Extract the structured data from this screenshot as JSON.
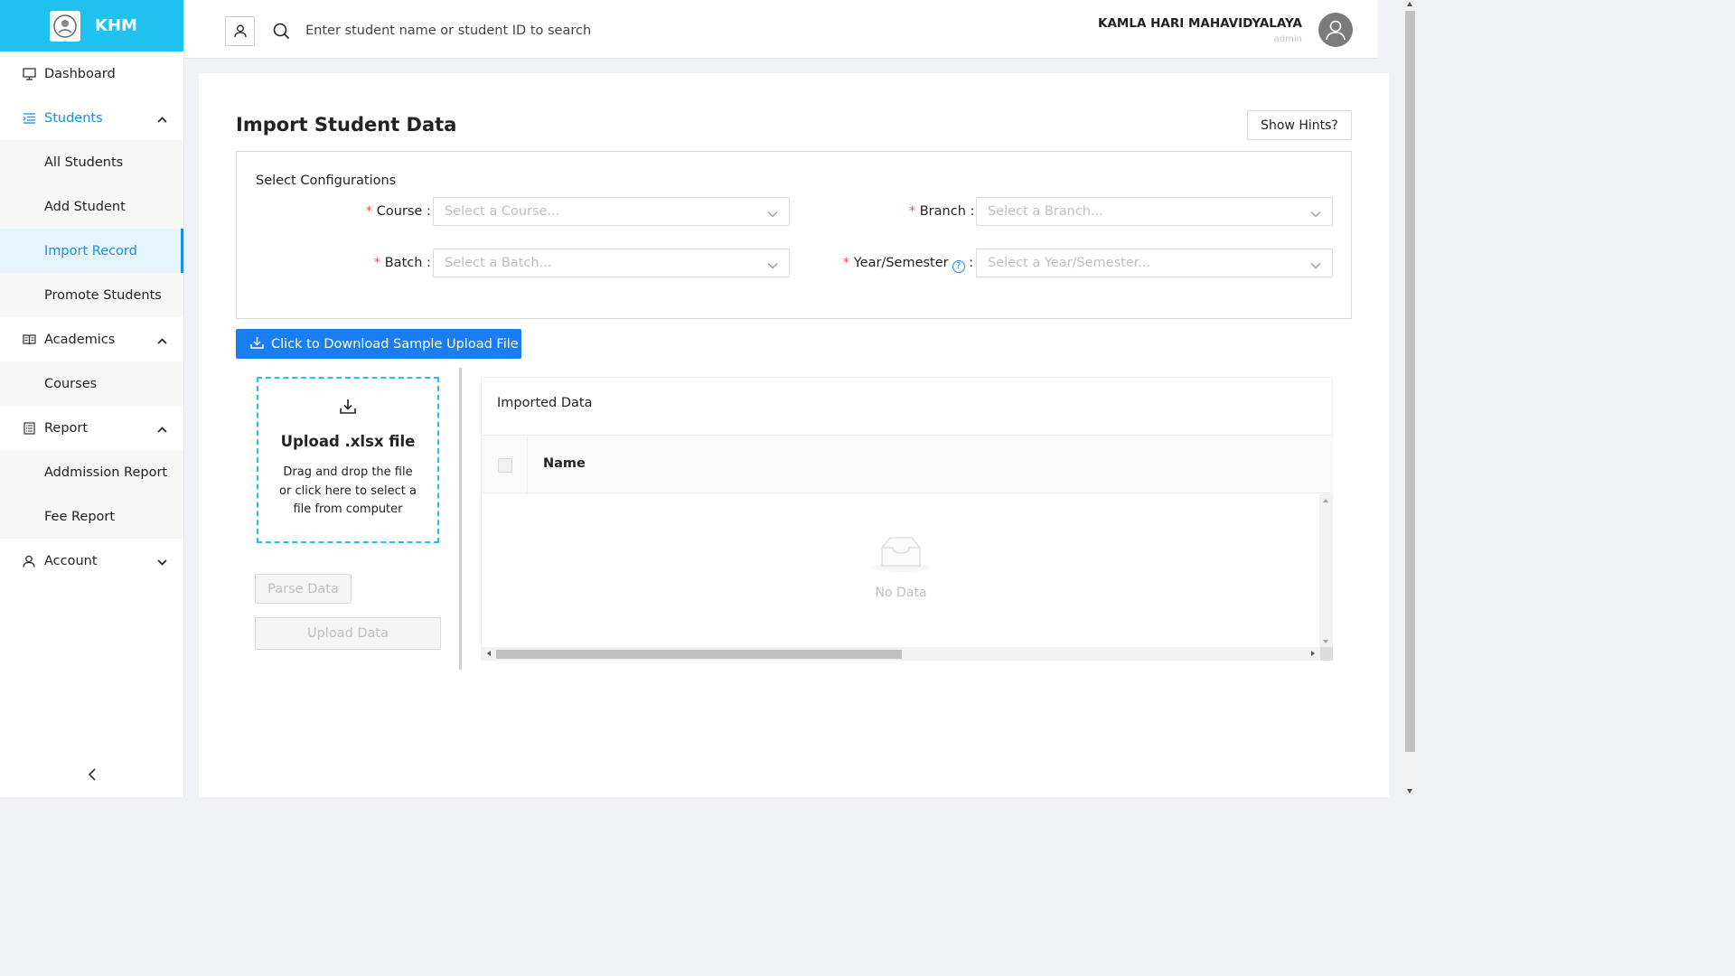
{
  "brand": {
    "name": "KHM"
  },
  "sidebar": {
    "items": [
      {
        "label": "Dashboard"
      },
      {
        "label": "Students"
      },
      {
        "label": "All Students"
      },
      {
        "label": "Add Student"
      },
      {
        "label": "Import Record"
      },
      {
        "label": "Promote Students"
      },
      {
        "label": "Academics"
      },
      {
        "label": "Courses"
      },
      {
        "label": "Report"
      },
      {
        "label": "Addmission Report"
      },
      {
        "label": "Fee Report"
      },
      {
        "label": "Account"
      }
    ]
  },
  "header": {
    "search_placeholder": "Enter student name or student ID to search",
    "org_name": "KAMLA HARI MAHAVIDYALAYA",
    "role": "admin"
  },
  "page": {
    "title": "Import Student Data",
    "hints_label": "Show Hints?",
    "config_title": "Select Configurations",
    "fields": {
      "course_label": "Course",
      "course_placeholder": "Select a Course...",
      "branch_label": "Branch",
      "branch_placeholder": "Select a Branch...",
      "batch_label": "Batch",
      "batch_placeholder": "Select a Batch...",
      "year_label": "Year/Semester",
      "year_placeholder": "Select a Year/Semester..."
    },
    "download_label": "Click to Download Sample Upload File",
    "upload": {
      "title": "Upload .xlsx file",
      "text": "Drag and drop the file or click here to select a file from computer"
    },
    "parse_label": "Parse Data",
    "upload_label": "Upload Data",
    "table": {
      "title": "Imported Data",
      "columns": [
        "Name"
      ],
      "empty_text": "No Data"
    }
  },
  "colors": {
    "brand": "#1ec2ec",
    "primary": "#1a7ef0",
    "active": "#1a8fe6",
    "required": "#ff4d4f"
  },
  "icons": [
    "monitor-icon",
    "list-icon",
    "book-icon",
    "report-icon",
    "user-icon",
    "search-icon",
    "download-icon",
    "upload-icon",
    "inbox-icon",
    "chevron-up-icon",
    "chevron-down-icon",
    "chevron-left-icon",
    "help-icon"
  ]
}
